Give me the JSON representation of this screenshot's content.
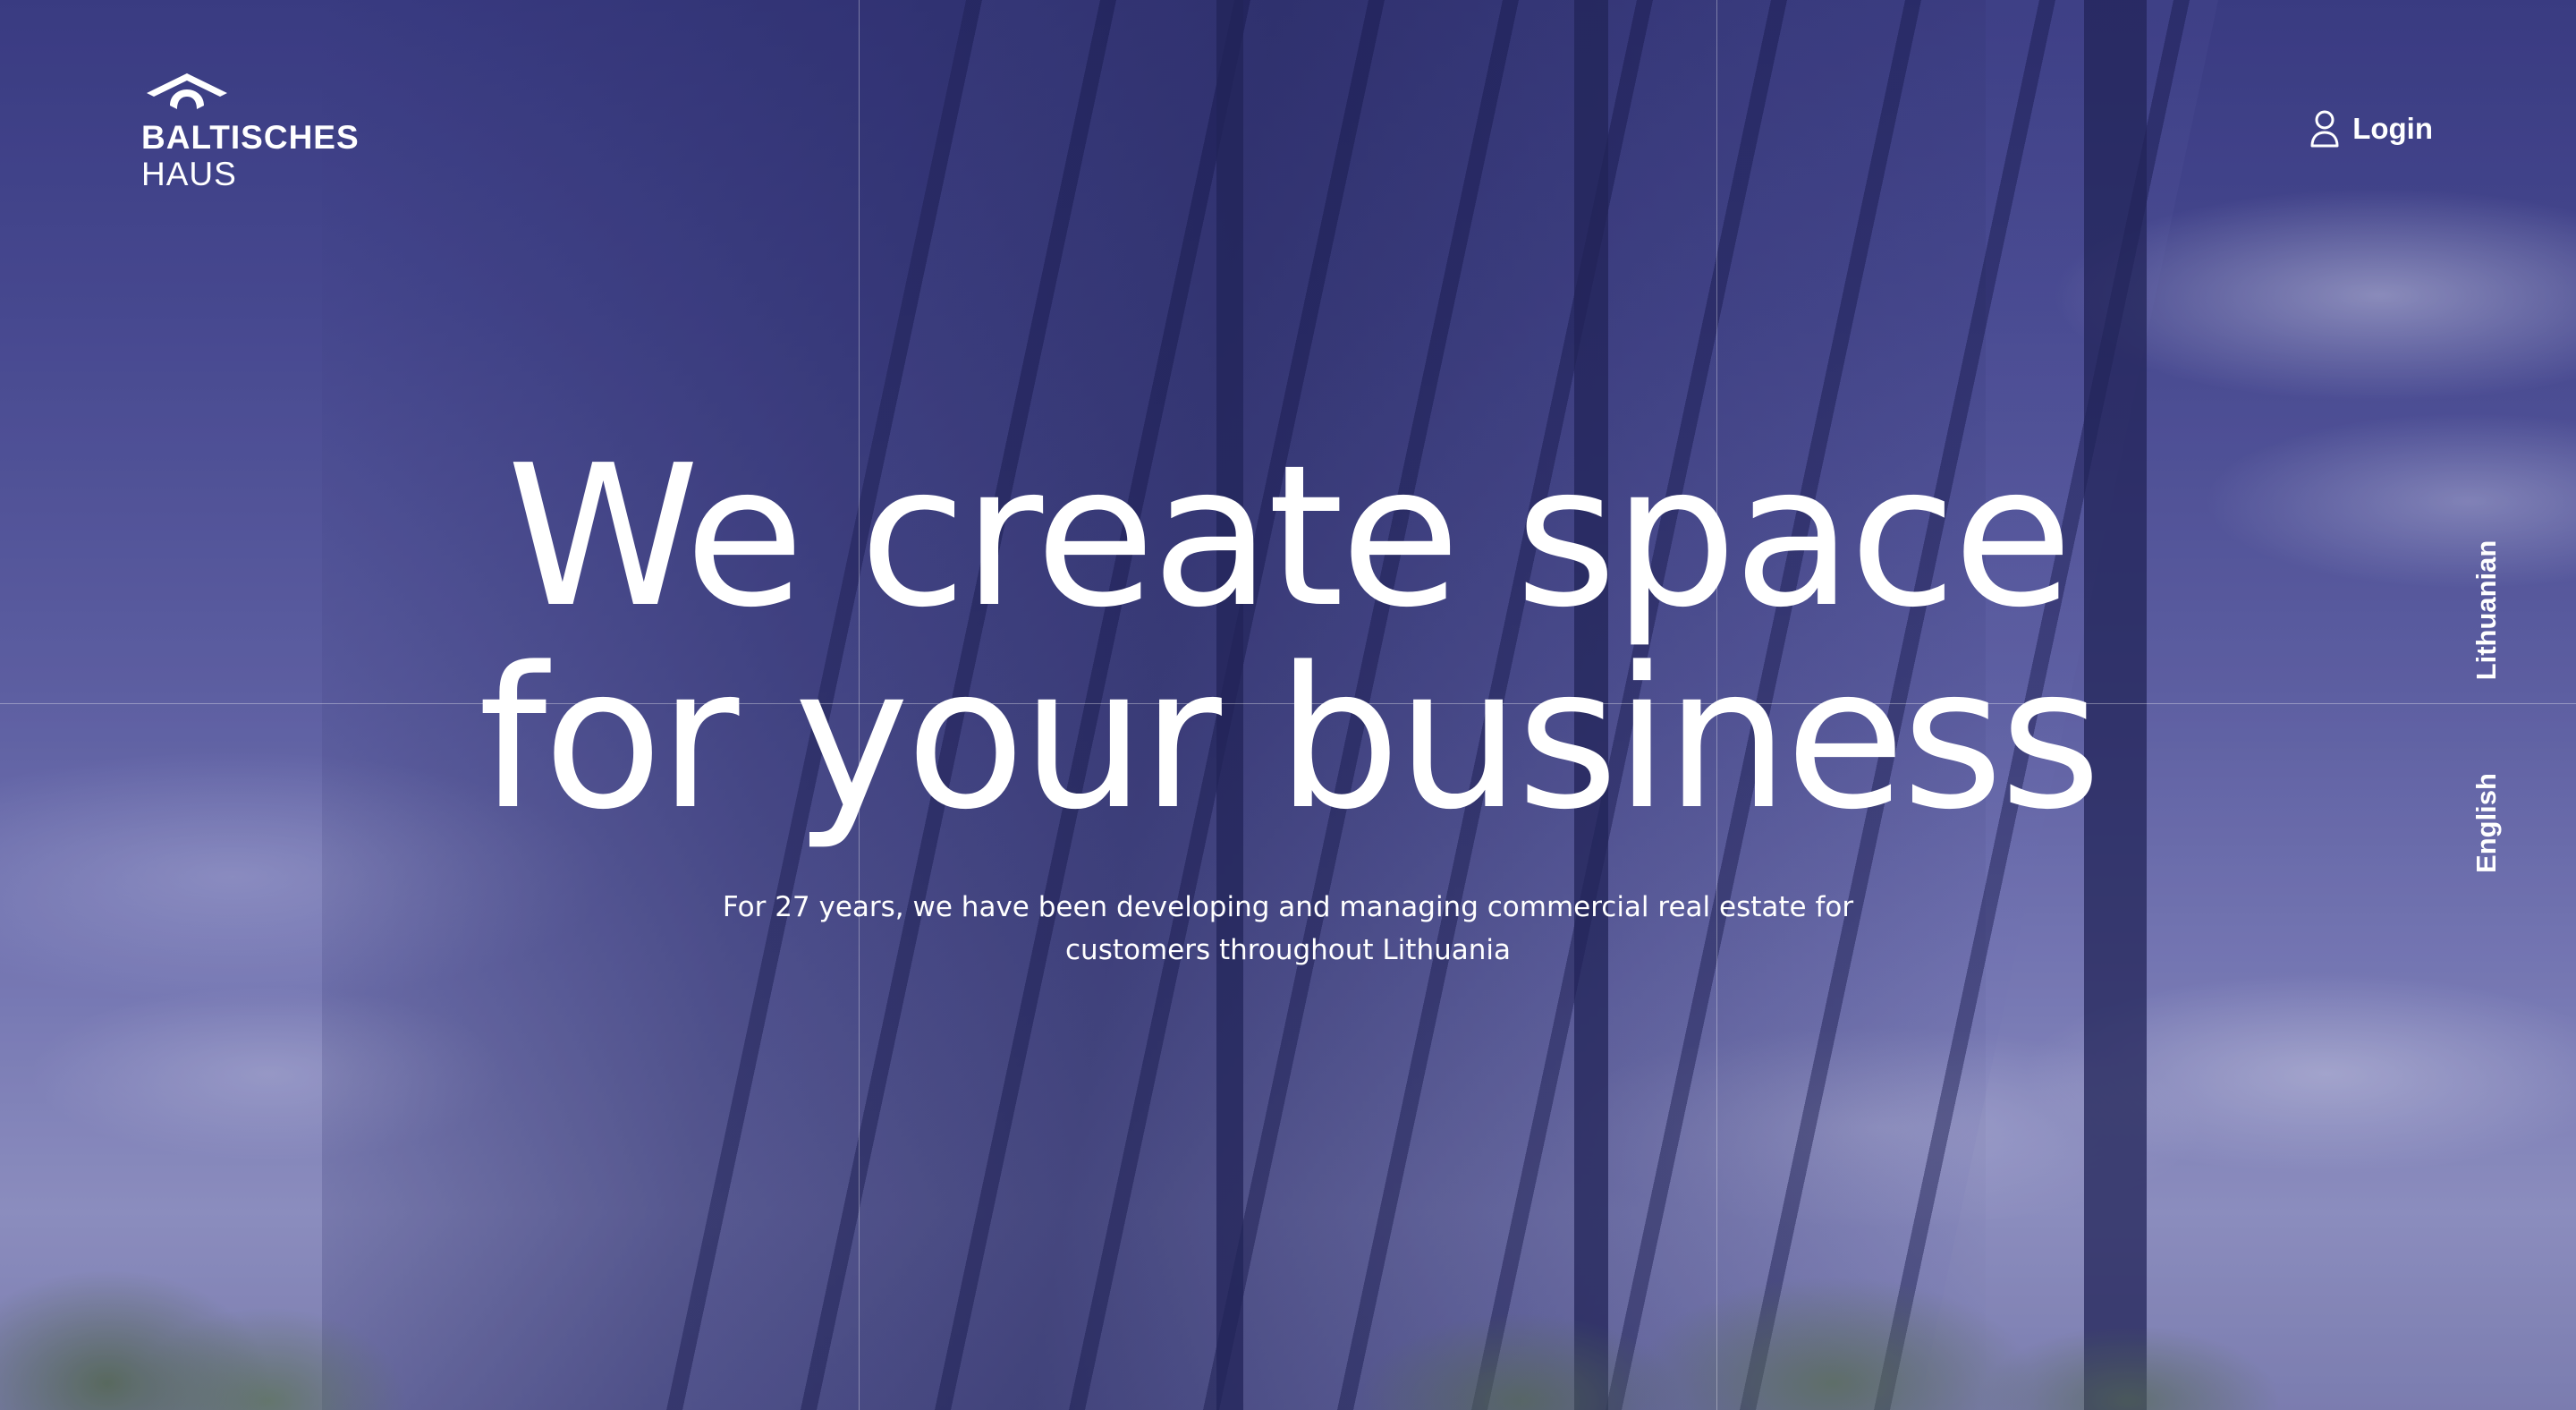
{
  "brand": {
    "name_line1": "BALTISCHES",
    "name_line2": "HAUS",
    "icon": "house-roof-logo-icon"
  },
  "header": {
    "login_label": "Login",
    "login_icon": "user-icon"
  },
  "languages": [
    {
      "label": "Lithuanian"
    },
    {
      "label": "English"
    }
  ],
  "hero": {
    "headline_line1": "We create space",
    "headline_line2": "for your business",
    "subtitle": "For 27 years, we have been developing and managing commercial real estate for customers throughout Lithuania"
  },
  "colors": {
    "text": "#ffffff",
    "overlay": "#3d3f86"
  }
}
